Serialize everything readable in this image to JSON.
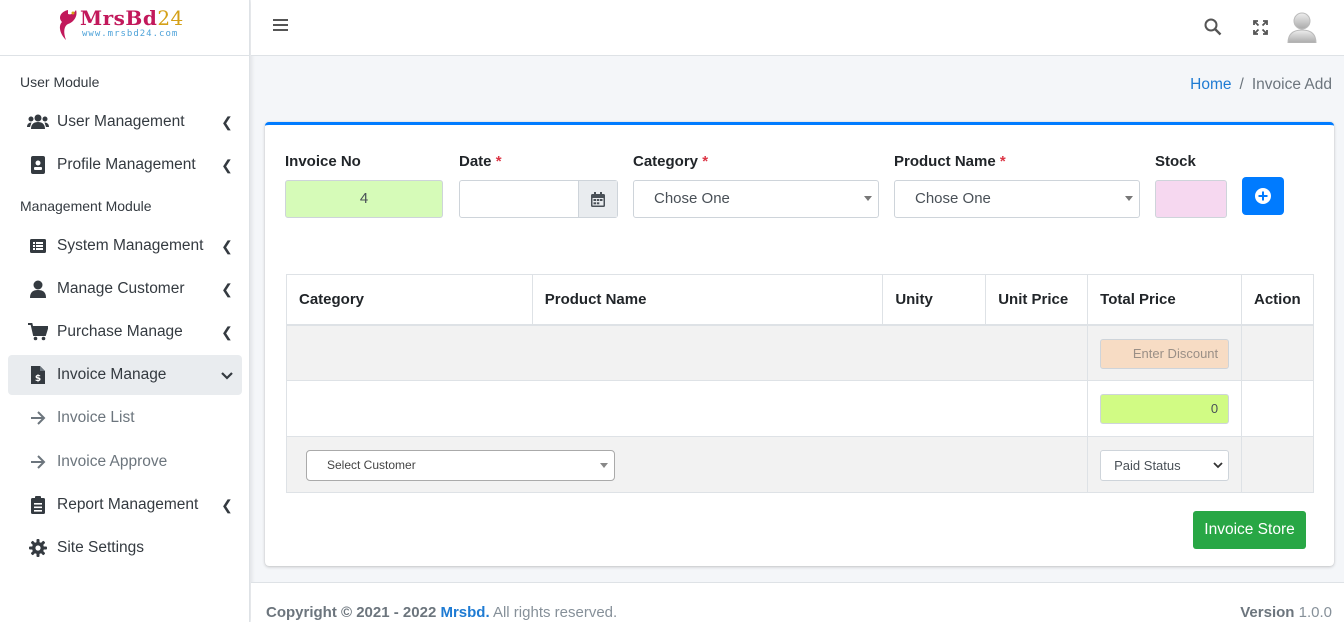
{
  "brand": {
    "name": "MrsBd",
    "num": "24",
    "url": "www.mrsbd24.com"
  },
  "sidebar": {
    "headers": [
      "User Module",
      "Management Module"
    ],
    "items": [
      {
        "label": "User Management",
        "icon": "users-icon"
      },
      {
        "label": "Profile Management",
        "icon": "id-badge-icon"
      },
      {
        "label": "System Management",
        "icon": "list-alt-icon"
      },
      {
        "label": "Manage Customer",
        "icon": "user-icon"
      },
      {
        "label": "Purchase Manage",
        "icon": "cart-icon"
      },
      {
        "label": "Invoice Manage",
        "icon": "invoice-icon"
      },
      {
        "label": "Invoice List",
        "icon": "arrow-right-icon"
      },
      {
        "label": "Invoice Approve",
        "icon": "arrow-right-icon"
      },
      {
        "label": "Report Management",
        "icon": "clipboard-icon"
      },
      {
        "label": "Site Settings",
        "icon": "gear-icon"
      }
    ]
  },
  "breadcrumb": {
    "home": "Home",
    "sep": "/",
    "current": "Invoice Add"
  },
  "form": {
    "invoice_no_label": "Invoice No",
    "invoice_no_value": "4",
    "date_label": "Date",
    "category_label": "Category",
    "category_value": "Chose One",
    "product_label": "Product Name",
    "product_value": "Chose One",
    "stock_label": "Stock",
    "required_mark": "*"
  },
  "table": {
    "headers": [
      "Category",
      "Product Name",
      "Unity",
      "Unit Price",
      "Total Price",
      "Action"
    ],
    "discount_placeholder": "Enter Discount",
    "total_value": "0",
    "customer_placeholder": "Select Customer",
    "paid_status": "Paid Status"
  },
  "buttons": {
    "store": "Invoice Store"
  },
  "footer": {
    "copyright": "Copyright © 2021 - 2022",
    "brand": "Mrsbd.",
    "rights": "All rights reserved.",
    "version_label": "Version",
    "version": "1.0.0"
  },
  "colors": {
    "primary": "#007bff",
    "success": "#28a745",
    "invoice_bg": "#d6fbb8",
    "stock_bg": "#f6d8f0",
    "discount_bg": "#f7dcc4",
    "total_bg": "#d1fb84"
  }
}
